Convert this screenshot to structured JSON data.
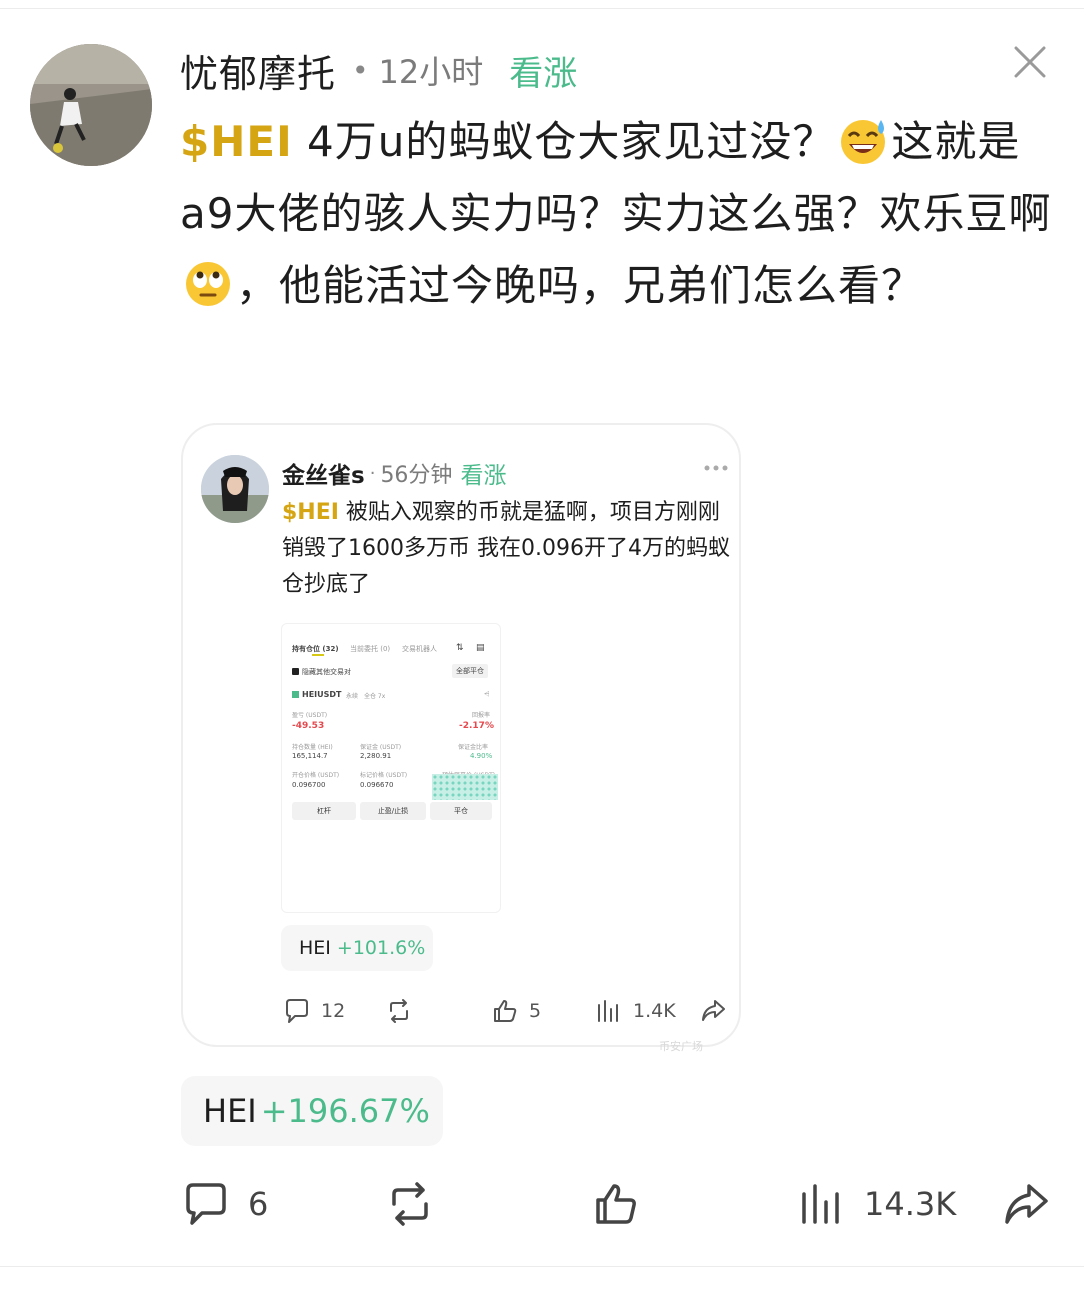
{
  "post": {
    "author": "忧郁摩托",
    "separator": "•",
    "time": "12小时",
    "sentiment": "看涨",
    "ticker": "$HEI",
    "text_part1": " 4万u的蚂蚁仓大家见过没？",
    "text_part2": "这就是a9大佬的骇人实力吗？实力这么强？欢乐豆啊",
    "text_part3": "，他能活过今晚吗，兄弟们怎么看？",
    "emoji1": "sweat-smile-emoji",
    "emoji2": "eye-roll-emoji",
    "coin_tag": {
      "symbol": "HEI",
      "change": "+196.67%"
    },
    "actions": {
      "comments": "6",
      "views": "14.3K"
    }
  },
  "quote": {
    "author": "金丝雀s",
    "separator": "·",
    "time": "56分钟",
    "sentiment": "看涨",
    "ticker": "$HEI",
    "text": " 被贴入观察的币就是猛啊，项目方刚刚销毁了1600多万币  我在0.096开了4万的蚂蚁仓抄底了",
    "coin_tag": {
      "symbol": "HEI",
      "change": "+101.6%"
    },
    "actions": {
      "comments": "12",
      "likes": "5",
      "views": "1.4K"
    },
    "screenshot": {
      "tab_positions": "持有仓位 (32)",
      "tab_orders": "当前委托 (0)",
      "tab_bots": "交易机器人",
      "hide_other": "隐藏其他交易对",
      "close_all": "全部平仓",
      "pair": "HEIUSDT",
      "pair_type": "永续",
      "pair_mode": "全仓 7x",
      "pnl_label": "盈亏 (USDT)",
      "pnl_value": "-49.53",
      "roi_label": "回报率",
      "roi_value": "-2.17%",
      "size_label": "持仓数量 (HEI)",
      "size_value": "165,114.7",
      "margin_label": "保证金 (USDT)",
      "margin_value": "2,280.91",
      "ratio_label": "保证金比率",
      "ratio_value": "4.90%",
      "entry_label": "开仓价格 (USDT)",
      "entry_value": "0.096700",
      "mark_label": "标记价格 (USDT)",
      "mark_value": "0.096670",
      "liq_label": "预估强平价 (USDT)",
      "btn_leverage": "杠杆",
      "btn_tpsl": "止盈/止损",
      "btn_close": "平仓"
    },
    "watermark": "币安广场"
  },
  "colors": {
    "accent_green": "#4cbb8c",
    "ticker_gold": "#d6a514",
    "loss_red": "#e5484d"
  }
}
